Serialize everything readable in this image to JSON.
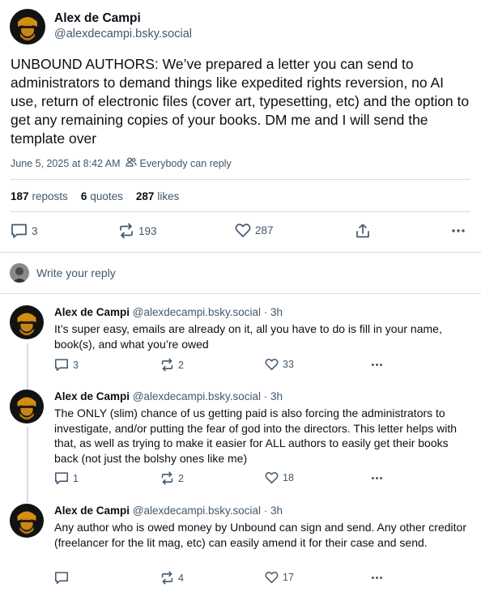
{
  "post": {
    "author_name": "Alex de Campi",
    "author_handle": "@alexdecampi.bsky.social",
    "text": "UNBOUND AUTHORS: We’ve prepared a letter you can send to administrators to demand things like expedited rights reversion, no AI use, return of electronic files (cover art, typesetting, etc) and the option to get any remaining copies of your books. DM me and I will send the template over",
    "timestamp": "June 5, 2025 at 8:42 AM",
    "reply_setting": "Everybody can reply",
    "stats": {
      "reposts_count": "187",
      "reposts_label": "reposts",
      "quotes_count": "6",
      "quotes_label": "quotes",
      "likes_count": "287",
      "likes_label": "likes"
    },
    "actions": {
      "replies": "3",
      "reposts": "193",
      "likes": "287"
    }
  },
  "composer": {
    "placeholder": "Write your reply"
  },
  "replies": [
    {
      "author_name": "Alex de Campi",
      "meta": " @alexdecampi.bsky.social · 3h",
      "text": "It’s super easy, emails are already on it, all you have to do is fill in your name, book(s), and what you’re owed",
      "replies": "3",
      "reposts": "2",
      "likes": "33"
    },
    {
      "author_name": "Alex de Campi",
      "meta": " @alexdecampi.bsky.social · 3h",
      "text": "The ONLY (slim) chance of us getting paid is also forcing the administrators to investigate, and/or putting the fear of god into the directors. This letter helps with that, as well as trying to make it easier for ALL authors to easily get their books back (not just the bolshy ones like me)",
      "replies": "1",
      "reposts": "2",
      "likes": "18"
    },
    {
      "author_name": "Alex de Campi",
      "meta": " @alexdecampi.bsky.social · 3h",
      "text": "Any author who is owed money by Unbound can sign and send. Any other creditor (freelancer for the lit mag, etc) can easily amend it for their case and send.",
      "replies": "",
      "reposts": "4",
      "likes": "17"
    }
  ],
  "icons": {
    "reply": "speech-bubble-icon",
    "repost": "repost-arrows-icon",
    "like": "heart-icon",
    "share": "share-upload-icon",
    "more": "ellipsis-icon",
    "reply_setting": "people-icon"
  }
}
